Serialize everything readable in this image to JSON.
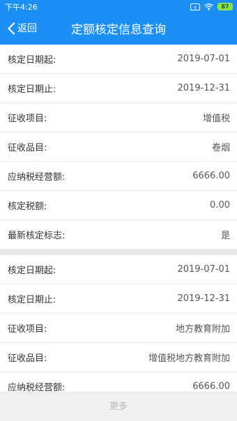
{
  "status_bar": {
    "time": "下午4:26",
    "sim_label": "×",
    "battery": "87"
  },
  "header": {
    "back_label": "返回",
    "title": "定额核定信息查询"
  },
  "records": [
    {
      "rows": [
        {
          "label": "核定日期起:",
          "value": "2019-07-01"
        },
        {
          "label": "核定日期止:",
          "value": "2019-12-31"
        },
        {
          "label": "征收项目:",
          "value": "增值税"
        },
        {
          "label": "征收品目:",
          "value": "卷烟"
        },
        {
          "label": "应纳税经营额:",
          "value": "6666.00"
        },
        {
          "label": "核定税额:",
          "value": "0.00"
        },
        {
          "label": "最新核定标志:",
          "value": "是"
        }
      ]
    },
    {
      "rows": [
        {
          "label": "核定日期起:",
          "value": "2019-07-01"
        },
        {
          "label": "核定日期止:",
          "value": "2019-12-31"
        },
        {
          "label": "征收项目:",
          "value": "地方教育附加"
        },
        {
          "label": "征收品目:",
          "value": "增值税地方教育附加"
        },
        {
          "label": "应纳税经营额:",
          "value": "6666.00"
        }
      ]
    }
  ],
  "footer": {
    "more_label": "更多"
  },
  "colors": {
    "header_bg": "#1a8ff5",
    "divider": "#e7e7e7"
  }
}
